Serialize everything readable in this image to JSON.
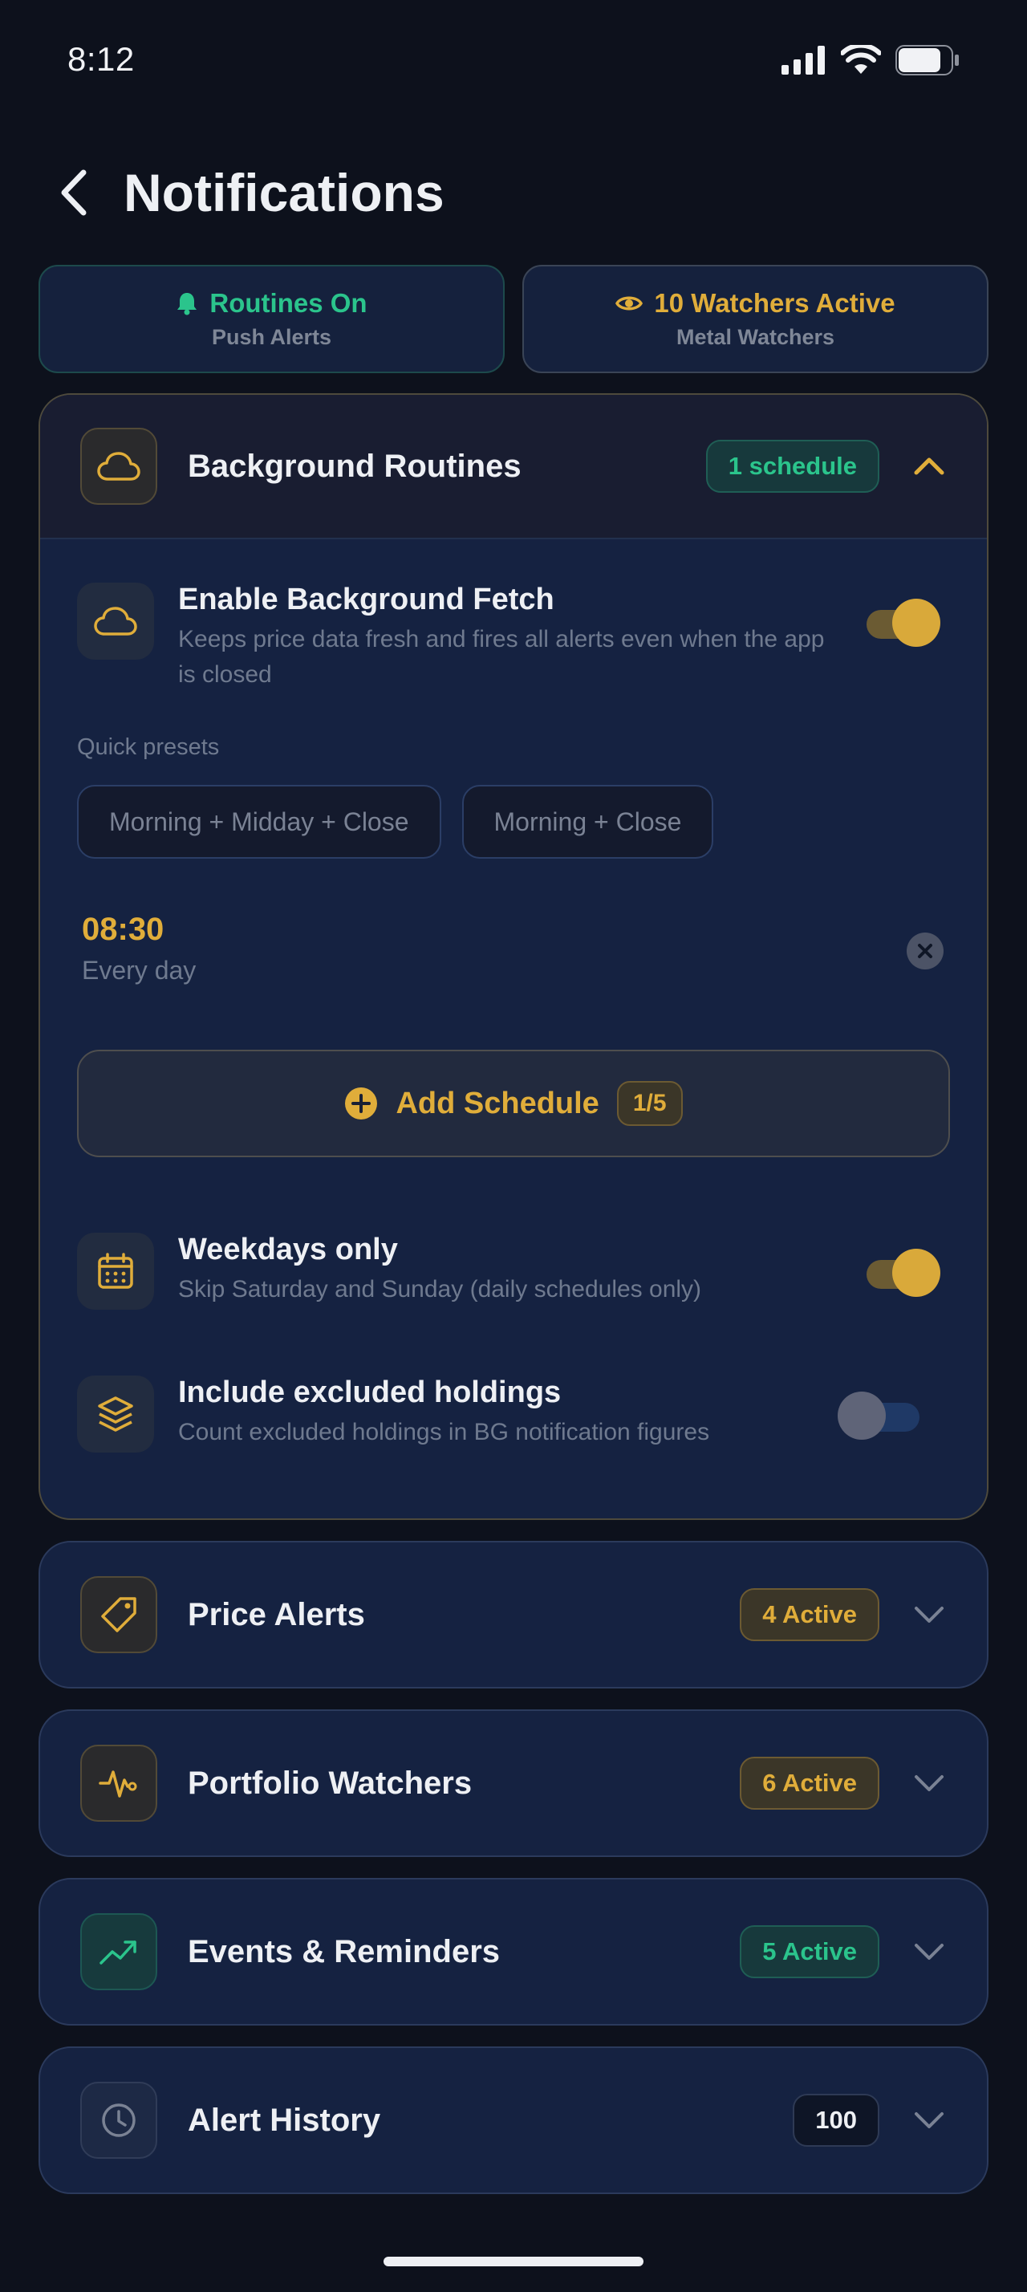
{
  "status_bar": {
    "time": "8:12"
  },
  "header": {
    "title": "Notifications"
  },
  "summary": {
    "routines": {
      "label": "Routines On",
      "sub": "Push Alerts"
    },
    "watchers": {
      "label": "10 Watchers Active",
      "sub": "Metal Watchers"
    }
  },
  "background_routines": {
    "title": "Background Routines",
    "badge": "1 schedule",
    "fetch": {
      "title": "Enable Background Fetch",
      "desc": "Keeps price data fresh and fires all alerts even when the app is closed",
      "enabled": true
    },
    "presets_label": "Quick presets",
    "presets": [
      "Morning + Midday + Close",
      "Morning + Close"
    ],
    "schedule": {
      "time": "08:30",
      "frequency": "Every day"
    },
    "add_schedule": {
      "label": "Add Schedule",
      "count": "1/5"
    },
    "weekdays": {
      "title": "Weekdays only",
      "desc": "Skip Saturday and Sunday (daily schedules only)",
      "enabled": true
    },
    "excluded": {
      "title": "Include excluded holdings",
      "desc": "Count excluded holdings in BG notification figures",
      "enabled": false
    }
  },
  "sections": [
    {
      "title": "Price Alerts",
      "badge": "4 Active",
      "icon": "tag-icon"
    },
    {
      "title": "Portfolio Watchers",
      "badge": "6 Active",
      "icon": "pulse-icon"
    },
    {
      "title": "Events & Reminders",
      "badge": "5 Active",
      "icon": "trending-up-icon"
    },
    {
      "title": "Alert History",
      "badge": "100",
      "icon": "clock-icon"
    }
  ],
  "colors": {
    "accent_gold": "#e0ad3a",
    "accent_green": "#2bc48c",
    "background": "#0d111c",
    "card": "#152241"
  }
}
